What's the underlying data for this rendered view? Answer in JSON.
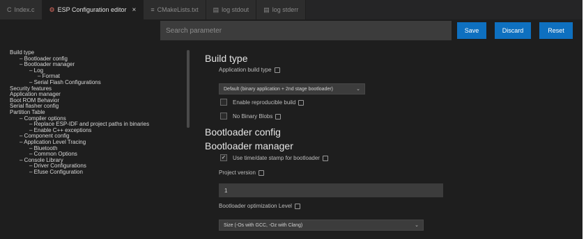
{
  "tabs": [
    {
      "label": "Index.c",
      "icon": "c-file-icon"
    },
    {
      "label": "ESP Configuration editor",
      "icon": "settings-icon",
      "close": "×"
    },
    {
      "label": "CMakeLists.txt",
      "icon": "file-icon"
    },
    {
      "label": "log stdout",
      "icon": "output-icon"
    },
    {
      "label": "log stderr",
      "icon": "output-icon"
    }
  ],
  "search": {
    "placeholder": "Search parameter"
  },
  "toolbar": {
    "save_label": "Save",
    "discard_label": "Discard",
    "reset_label": "Reset"
  },
  "sidebar": {
    "items": [
      {
        "label": "Build type",
        "level": 0
      },
      {
        "label": "Bootloader config",
        "level": 1
      },
      {
        "label": "Bootloader manager",
        "level": 1
      },
      {
        "label": "Log",
        "level": 2
      },
      {
        "label": "Format",
        "level": 3
      },
      {
        "label": "Serial Flash Configurations",
        "level": 2
      },
      {
        "label": "Security features",
        "level": 0
      },
      {
        "label": "Application manager",
        "level": 0
      },
      {
        "label": "Boot ROM Behavior",
        "level": 0
      },
      {
        "label": "Serial flasher config",
        "level": 0
      },
      {
        "label": "Partition Table",
        "level": 0
      },
      {
        "label": "Compiler options",
        "level": 1
      },
      {
        "label": "Replace ESP-IDF and project paths in binaries",
        "level": 2
      },
      {
        "label": "Enable C++ exceptions",
        "level": 2
      },
      {
        "label": "Component config",
        "level": 1
      },
      {
        "label": "Application Level Tracing",
        "level": 1
      },
      {
        "label": "Bluetooth",
        "level": 2
      },
      {
        "label": "Common Options",
        "level": 2
      },
      {
        "label": "Console Library",
        "level": 1
      },
      {
        "label": "Driver Configurations",
        "level": 2
      },
      {
        "label": "Efuse Configuration",
        "level": 2
      }
    ]
  },
  "main": {
    "build_type_title": "Build type",
    "app_build_type_label": "Application build type",
    "app_build_type_value": "Default (binary application + 2nd stage bootloader)",
    "reproducible_label": "Enable reproducible build",
    "no_binary_label": "No Binary Blobs",
    "bootloader_config_title": "Bootloader config",
    "bootloader_manager_title": "Bootloader manager",
    "use_time_label": "Use time/date stamp for bootloader",
    "use_time_checked": true,
    "project_version_label": "Project version",
    "project_version_value": "1",
    "opt_level_label": "Bootloader optimization Level",
    "opt_level_value": "Size (-Os with GCC, -Oz with Clang)"
  },
  "icons": {
    "chevron": "⌄",
    "check": "✓"
  },
  "colors": {
    "accent": "#0e70c0",
    "background": "#1e1e1e",
    "input": "#3c3c3c"
  }
}
